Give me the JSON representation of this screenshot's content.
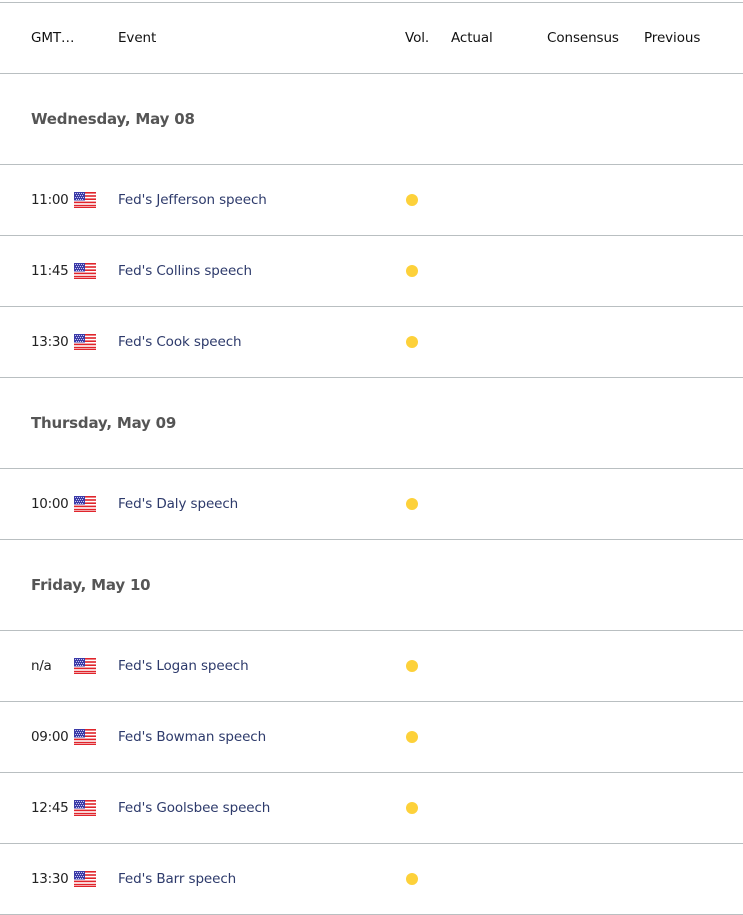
{
  "header": {
    "time": "GMT…",
    "event": "Event",
    "vol": "Vol.",
    "actual": "Actual",
    "consensus": "Consensus",
    "previous": "Previous"
  },
  "colors": {
    "volatility_low": "#fdd13a",
    "event_text": "#2d3a6b",
    "divider": "#b9bfc1"
  },
  "days": [
    {
      "label": "Wednesday, May 08",
      "events": [
        {
          "time": "11:00",
          "country": "us-flag",
          "name": "Fed's Jefferson speech",
          "volatility": "low",
          "actual": "",
          "consensus": "",
          "previous": ""
        },
        {
          "time": "11:45",
          "country": "us-flag",
          "name": "Fed's Collins speech",
          "volatility": "low",
          "actual": "",
          "consensus": "",
          "previous": ""
        },
        {
          "time": "13:30",
          "country": "us-flag",
          "name": "Fed's Cook speech",
          "volatility": "low",
          "actual": "",
          "consensus": "",
          "previous": ""
        }
      ]
    },
    {
      "label": "Thursday, May 09",
      "events": [
        {
          "time": "10:00",
          "country": "us-flag",
          "name": "Fed's Daly speech",
          "volatility": "low",
          "actual": "",
          "consensus": "",
          "previous": ""
        }
      ]
    },
    {
      "label": "Friday, May 10",
      "events": [
        {
          "time": "n/a",
          "country": "us-flag",
          "name": "Fed's Logan speech",
          "volatility": "low",
          "actual": "",
          "consensus": "",
          "previous": ""
        },
        {
          "time": "09:00",
          "country": "us-flag",
          "name": "Fed's Bowman speech",
          "volatility": "low",
          "actual": "",
          "consensus": "",
          "previous": ""
        },
        {
          "time": "12:45",
          "country": "us-flag",
          "name": "Fed's Goolsbee speech",
          "volatility": "low",
          "actual": "",
          "consensus": "",
          "previous": ""
        },
        {
          "time": "13:30",
          "country": "us-flag",
          "name": "Fed's Barr speech",
          "volatility": "low",
          "actual": "",
          "consensus": "",
          "previous": ""
        }
      ]
    }
  ]
}
